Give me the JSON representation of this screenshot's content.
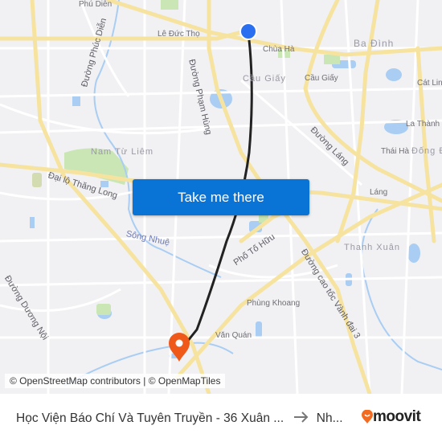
{
  "map": {
    "labels": {
      "phu_dien": "Phú Diễn",
      "le_duc_tho": "Lê Đức Thọ",
      "duong_phuc_dien": "Đường Phúc Diễn",
      "duong_pham_hung": "Đường Phạm Hùng",
      "chua_ha": "Chùa Hà",
      "ba_dinh": "Ba Đình",
      "cau_giay_area": "Cầu Giấy",
      "cau_giay": "Cầu Giấy",
      "cat_linh": "Cát Linh",
      "la_thanh": "La Thành",
      "thai_ha": "Thái Hà",
      "dong_da": "Đống Đa",
      "duong_lang": "Đường Láng",
      "lang": "Láng",
      "nam_tu_liem": "Nam Từ Liêm",
      "dai_lo_thang_long": "Đại lộ Thăng Long",
      "song_nhue": "Sông Nhuệ",
      "pho_to_huu": "Phố Tố Hữu",
      "duong_vanh_dai_3": "Đường cao tốc Vành đai 3",
      "thanh_xuan": "Thanh Xuân",
      "phung_khoang": "Phùng Khoang",
      "van_quan": "Văn Quán",
      "duong_duong_noi": "Đường Dương Nội"
    },
    "origin_marker": {
      "icon": "origin-dot-icon",
      "color": "#2a6ff0"
    },
    "destination_marker": {
      "icon": "destination-pin-icon",
      "color": "#ef5a1a"
    },
    "route_color": "#222222",
    "attribution": "© OpenStreetMap contributors | © OpenMapTiles"
  },
  "cta": {
    "label": "Take me there",
    "color": "#0a73d6"
  },
  "footer": {
    "origin": "Học Viện Báo Chí Và Tuyên Truyền - 36 Xuân ...",
    "arrow_icon": "arrow-right-icon",
    "destination": "Nh...",
    "brand": "moovit",
    "brand_color": "#f26b21"
  }
}
